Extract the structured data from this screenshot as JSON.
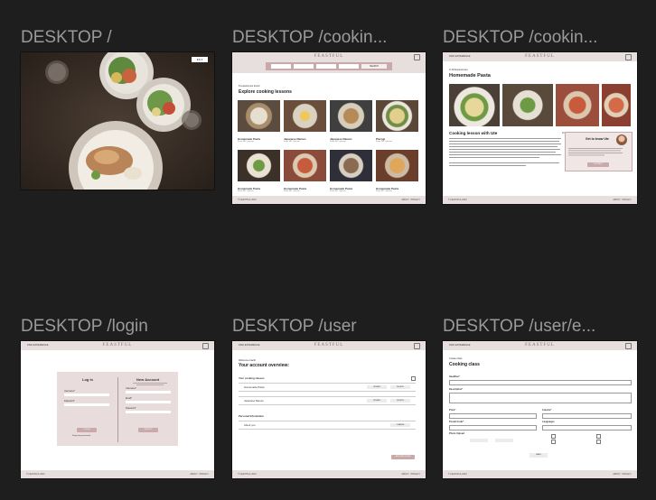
{
  "frames": [
    {
      "label": "DESKTOP /",
      "name": "desktop-home"
    },
    {
      "label": "DESKTOP /cookin...",
      "name": "desktop-cooking-lessons"
    },
    {
      "label": "DESKTOP /cookin...",
      "name": "desktop-cooking-lesson-detail"
    },
    {
      "label": "DESKTOP /login",
      "name": "desktop-login"
    },
    {
      "label": "DESKTOP /user",
      "name": "desktop-user"
    },
    {
      "label": "DESKTOP /user/e...",
      "name": "desktop-user-edit"
    }
  ],
  "home": {
    "button": "EN ▾"
  },
  "header": {
    "logo": "FEASTFUL",
    "nav": "FIND EXPERIENCE"
  },
  "footer": {
    "left": "© FEASTFUL 2023",
    "about": "ABOUT",
    "privacy": "PRIVACY"
  },
  "lessons": {
    "results": "8 experiences found",
    "title": "Explore cooking lessons",
    "search_button": "SEARCH",
    "items": [
      {
        "title": "Homemade Pasta",
        "meta": "From 30€ / person"
      },
      {
        "title": "Japanese Ramen",
        "meta": "From 30€ / person"
      },
      {
        "title": "Japanese Ramen",
        "meta": "From 30€ / person"
      },
      {
        "title": "Pierogi",
        "meta": "From 30€ / person"
      },
      {
        "title": "Homemade Pasta",
        "meta": "From 30€ / person"
      },
      {
        "title": "Homemade Pasta",
        "meta": "From 30€ / person"
      },
      {
        "title": "Homemade Pasta",
        "meta": "From 30€ / person"
      },
      {
        "title": "Homemade Pasta",
        "meta": "From 30€ / person"
      }
    ]
  },
  "detail": {
    "kicker": "In All Experiences",
    "title": "Homemade Pasta",
    "subtitle": "Cooking lesson with Ute",
    "price": "From 30€ / person",
    "card_title": "Get to know Ute",
    "card_button": "CONTACT"
  },
  "login": {
    "login_title": "Log in",
    "new_title": "New Account",
    "user_label": "Username*",
    "pass_label": "Password*",
    "login_button": "LOGIN",
    "forgot": "Forgot my password",
    "email_label": "Email*",
    "signup_button": "SIGN UP"
  },
  "user": {
    "welcome": "Welcome back!",
    "title": "Your account overview:",
    "classes_heading": "Your cooking classes",
    "classes": [
      {
        "name": "Homemade Pasta",
        "edit": "UPDATE",
        "delete": "DELETE"
      },
      {
        "name": "Japanese Ramen",
        "edit": "UPDATE",
        "delete": "DELETE"
      }
    ],
    "personal_heading": "Personal Information",
    "about_label": "About you",
    "about_button": "CHANGE",
    "bottom_button": "ADD NEW CLASS"
  },
  "edit": {
    "kicker": "Create class",
    "title": "Cooking class",
    "headline": "Headline*",
    "description": "Description*",
    "price": "Price*",
    "cuisine": "Cuisine*",
    "postal": "Postal Code*",
    "languages": "Languages",
    "photo": "Photo Upload",
    "save": "SAVE"
  }
}
